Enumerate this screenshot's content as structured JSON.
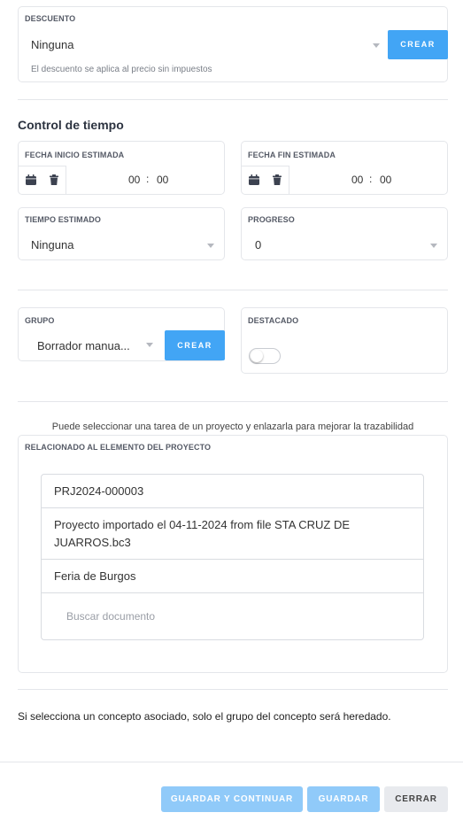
{
  "discount": {
    "label": "DESCUENTO",
    "value": "Ninguna",
    "create_label": "CREAR",
    "hint": "El descuento se aplica al precio sin impuestos"
  },
  "time_control": {
    "title": "Control de tiempo",
    "start": {
      "label": "FECHA INICIO ESTIMADA",
      "hours": "00",
      "minutes": "00",
      "separator": ":"
    },
    "end": {
      "label": "FECHA FIN ESTIMADA",
      "hours": "00",
      "minutes": "00",
      "separator": ":"
    },
    "estimated_time": {
      "label": "TIEMPO ESTIMADO",
      "value": "Ninguna"
    },
    "progress": {
      "label": "PROGRESO",
      "value": "0"
    }
  },
  "group": {
    "label": "GRUPO",
    "value": "Borrador manua...",
    "create_label": "CREAR"
  },
  "featured": {
    "label": "DESTACADO",
    "enabled": false
  },
  "related": {
    "intro": "Puede seleccionar una tarea de un proyecto y enlazarla para mejorar la trazabilidad",
    "label": "RELACIONADO AL ELEMENTO DEL PROYECTO",
    "items": [
      "PRJ2024-000003",
      "Proyecto importado el 04-11-2024 from file STA CRUZ DE JUARROS.bc3",
      "Feria de Burgos"
    ],
    "search_placeholder": "Buscar documento"
  },
  "concept_note": "Si selecciona un concepto asociado, solo el grupo del concepto será heredado.",
  "footer": {
    "save_continue": "GUARDAR Y CONTINUAR",
    "save": "GUARDAR",
    "close": "CERRAR"
  },
  "colors": {
    "primary": "#42a5f5",
    "primary_light": "#90caf9",
    "close_bg": "#e8eaee"
  }
}
